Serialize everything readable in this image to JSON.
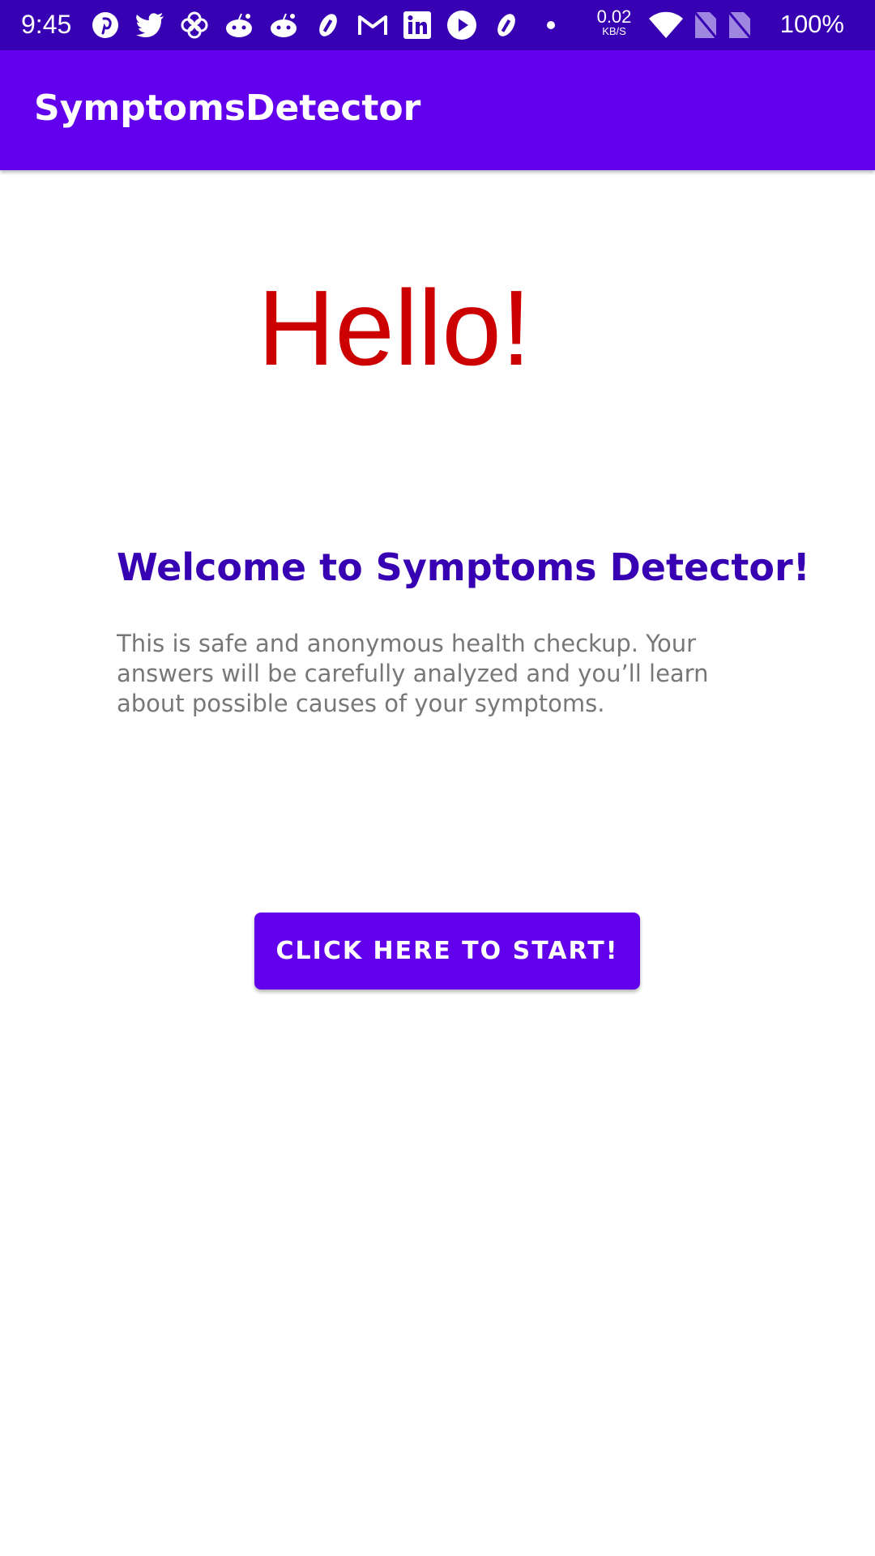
{
  "status_bar": {
    "time": "9:45",
    "net_speed_value": "0.02",
    "net_speed_unit": "KB/S",
    "battery": "100%",
    "notification_icons": [
      "pinterest-icon",
      "twitter-icon",
      "pinwheel-icon",
      "reddit-icon",
      "reddit-icon",
      "app-icon",
      "gmail-icon",
      "linkedin-icon",
      "youtube-icon",
      "app-icon",
      "dot-icon"
    ],
    "system_icons": [
      "wifi-icon",
      "no-sim-icon",
      "no-sim-icon"
    ]
  },
  "app_bar": {
    "title": "SymptomsDetector"
  },
  "main": {
    "hello": "Hello!",
    "welcome": "Welcome to Symptoms Detector!",
    "description": "This is safe and anonymous health checkup. Your answers will be carefully analyzed and you’ll learn about possible causes of your symptoms.",
    "start_button": "CLICK HERE TO START!"
  },
  "colors": {
    "status_bar": "#3700b3",
    "app_bar": "#6200ee",
    "hello": "#cc0000",
    "welcome": "#3700b3",
    "description": "#777777",
    "button": "#6200ee"
  }
}
